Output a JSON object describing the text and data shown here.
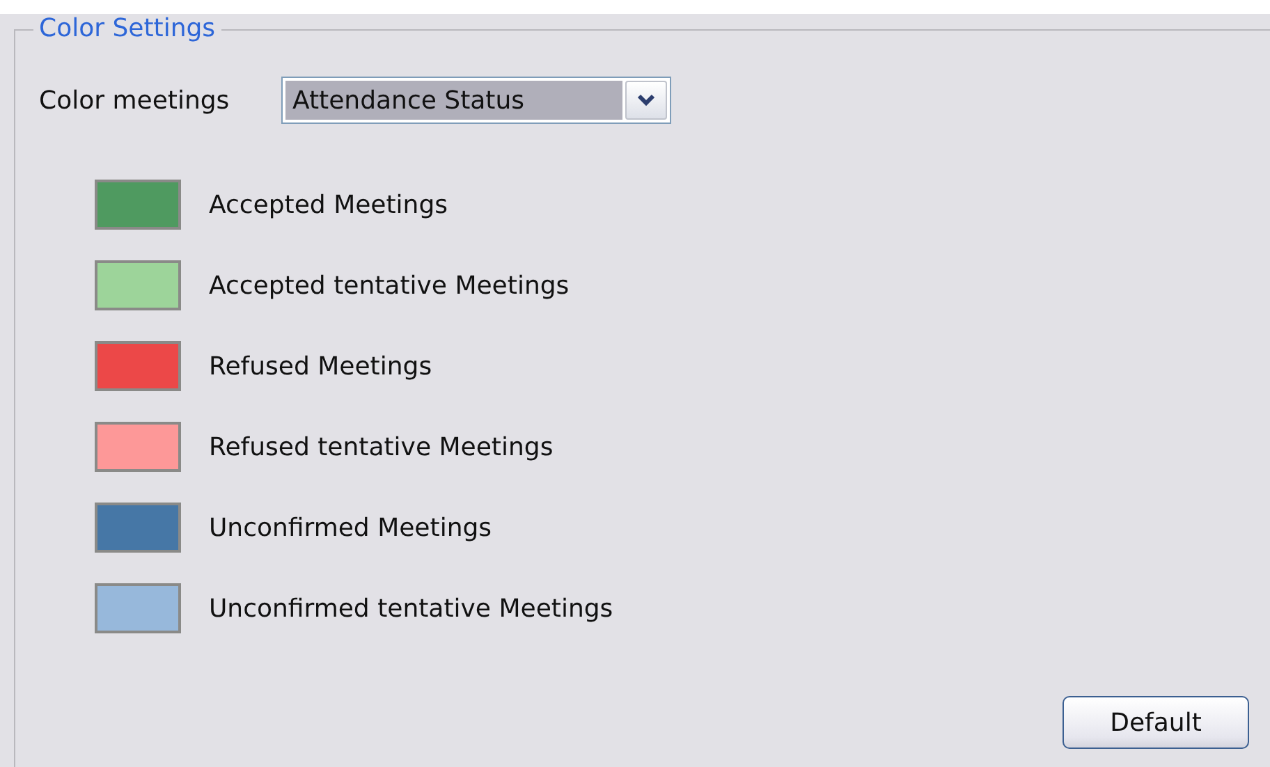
{
  "group": {
    "title": "Color Settings"
  },
  "color_meetings": {
    "label": "Color meetings",
    "value": "Attendance Status"
  },
  "legend": [
    {
      "label": "Accepted Meetings",
      "color": "#4f9a60"
    },
    {
      "label": "Accepted tentative Meetings",
      "color": "#9dd49a"
    },
    {
      "label": "Refused Meetings",
      "color": "#ec4848"
    },
    {
      "label": "Refused tentative Meetings",
      "color": "#fd9898"
    },
    {
      "label": "Unconfirmed Meetings",
      "color": "#4677a6"
    },
    {
      "label": "Unconfirmed tentative Meetings",
      "color": "#97b8db"
    }
  ],
  "buttons": [
    "Default"
  ]
}
